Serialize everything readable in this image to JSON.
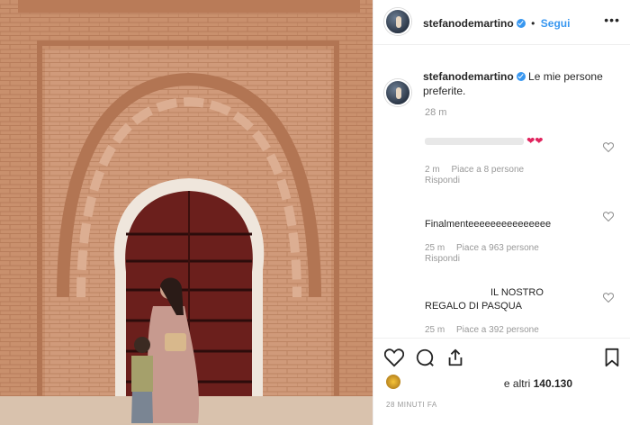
{
  "header": {
    "username": "stefanodemartino",
    "separator": "•",
    "follow_label": "Segui",
    "more_label": "•••"
  },
  "caption": {
    "username": "stefanodemartino",
    "text": "Le mie persone preferite.",
    "time": "28 m"
  },
  "comments": [
    {
      "text_suffix": "❤❤",
      "time": "2 m",
      "likes": "Piace a 8 persone",
      "reply": "Rispondi"
    },
    {
      "text": "Finalmenteeeeeeeeeeeeeee",
      "time": "25 m",
      "likes": "Piace a 963 persone",
      "reply": "Rispondi"
    },
    {
      "text": "IL NOSTRO REGALO DI PASQUA",
      "time": "25 m",
      "likes": "Piace a 392 persone"
    }
  ],
  "actions": {
    "icons": [
      "heart-outline-icon",
      "comment-bubble-icon",
      "share-icon",
      "bookmark-icon"
    ]
  },
  "likes": {
    "prefix": "e altri ",
    "count": "140.130"
  },
  "post_time": "28 MINUTI FA",
  "colors": {
    "accent_blue": "#3897f0",
    "heart_red": "#e0245e",
    "brick": "#c98f6c",
    "door": "#6b1f1c"
  }
}
